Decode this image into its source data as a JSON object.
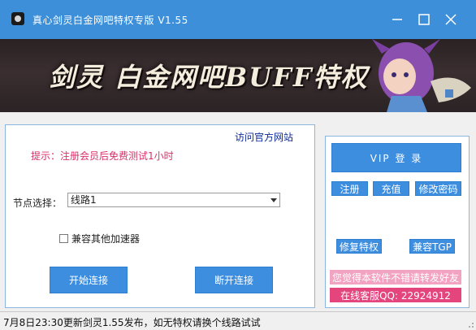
{
  "window": {
    "title": "真心剑灵白金网吧特权专版 V1.55",
    "controls": [
      "minimize-icon",
      "maximize-icon",
      "close-icon"
    ]
  },
  "banner": {
    "title": "剑灵 白金网吧BUFF特权"
  },
  "main": {
    "official_link": "访问官方网站",
    "hint": "提示：注册会员后免费测试1小时",
    "node_label": "节点选择：",
    "node_value": "线路1",
    "compat_label": "兼容其他加速器",
    "compat_checked": false,
    "start_button": "开始连接",
    "disconnect_button": "断开连接"
  },
  "side": {
    "vip_login": "VIP 登 录",
    "register": "注册",
    "recharge": "充值",
    "change_password": "修改密码",
    "fix_privilege": "修复特权",
    "compat_tgp": "兼容TGP",
    "share_text": "您觉得本软件不错请转发好友",
    "service_text": "在线客服QQ: 22924912"
  },
  "status": {
    "text": "7月8日23:30更新剑灵1.55发布，如无特权请换个线路试试"
  },
  "colors": {
    "titlebar": "#3c8fd8",
    "button": "#3e8ee0",
    "hint": "#d8306a",
    "share_bar": "#f3a3c2",
    "service_bar": "#e5457d"
  }
}
